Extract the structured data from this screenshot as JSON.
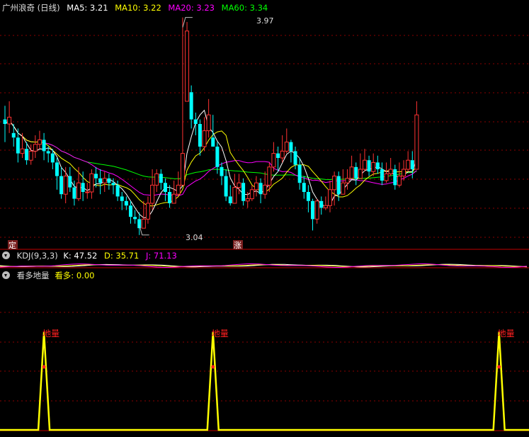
{
  "main_panel": {
    "title": "广州浪奇 (日线)",
    "ma_labels": [
      {
        "label": "MA5: 3.21",
        "color": "#ffffff"
      },
      {
        "label": "MA10: 3.22",
        "color": "#ffff00"
      },
      {
        "label": "MA20: 3.23",
        "color": "#ff00ff"
      },
      {
        "label": "MA60: 3.34",
        "color": "#00ff00"
      }
    ],
    "high_label": "3.97",
    "low_label": "3.04",
    "marker_ding": "定",
    "marker_zhang": "涨"
  },
  "kdj_panel": {
    "title": "KDJ(9,3,3)",
    "k_label": "K: 47.52",
    "d_label": "D: 35.71",
    "j_label": "J: 71.13"
  },
  "indicator_panel": {
    "title": "看多地量",
    "value_label": "看多: 0.00",
    "peak_label": "地量"
  },
  "colors": {
    "up": "#ff3232",
    "down": "#00ffff",
    "ma5": "#ffffff",
    "ma10": "#ffff00",
    "ma20": "#ff00ff",
    "ma60": "#00ff00",
    "signal": "#ffff00",
    "grid": "#8b0000"
  },
  "chart_data": [
    {
      "type": "candlestick",
      "title": "广州浪奇 (日线)",
      "series_names": [
        "MA5",
        "MA10",
        "MA20",
        "MA60"
      ],
      "yrange": [
        3.0,
        4.0
      ],
      "candles": [
        [
          3.52,
          3.5,
          3.58,
          3.42
        ],
        [
          3.5,
          3.53,
          3.6,
          3.46
        ],
        [
          3.46,
          3.44,
          3.5,
          3.4
        ],
        [
          3.44,
          3.37,
          3.48,
          3.33
        ],
        [
          3.37,
          3.39,
          3.46,
          3.35
        ],
        [
          3.39,
          3.34,
          3.42,
          3.32
        ],
        [
          3.34,
          3.38,
          3.41,
          3.32
        ],
        [
          3.38,
          3.41,
          3.45,
          3.35
        ],
        [
          3.41,
          3.43,
          3.47,
          3.39
        ],
        [
          3.43,
          3.38,
          3.46,
          3.34
        ],
        [
          3.38,
          3.37,
          3.4,
          3.33
        ],
        [
          3.37,
          3.33,
          3.39,
          3.3
        ],
        [
          3.33,
          3.27,
          3.35,
          3.21
        ],
        [
          3.27,
          3.19,
          3.31,
          3.17
        ],
        [
          3.19,
          3.27,
          3.31,
          3.15
        ],
        [
          3.27,
          3.22,
          3.31,
          3.2
        ],
        [
          3.22,
          3.17,
          3.25,
          3.14
        ],
        [
          3.17,
          3.24,
          3.31,
          3.16
        ],
        [
          3.24,
          3.2,
          3.29,
          3.16
        ],
        [
          3.2,
          3.2,
          3.24,
          3.17
        ],
        [
          3.2,
          3.28,
          3.3,
          3.17
        ],
        [
          3.28,
          3.26,
          3.31,
          3.22
        ],
        [
          3.26,
          3.24,
          3.3,
          3.19
        ],
        [
          3.24,
          3.26,
          3.29,
          3.2
        ],
        [
          3.26,
          3.24,
          3.28,
          3.21
        ],
        [
          3.24,
          3.23,
          3.26,
          3.19
        ],
        [
          3.23,
          3.18,
          3.25,
          3.16
        ],
        [
          3.18,
          3.16,
          3.2,
          3.12
        ],
        [
          3.16,
          3.14,
          3.18,
          3.12
        ],
        [
          3.14,
          3.09,
          3.16,
          3.06
        ],
        [
          3.09,
          3.08,
          3.12,
          3.06
        ],
        [
          3.08,
          3.04,
          3.11,
          3.01
        ],
        [
          3.04,
          3.08,
          3.16,
          3.04
        ],
        [
          3.08,
          3.15,
          3.18,
          3.06
        ],
        [
          3.15,
          3.23,
          3.3,
          3.12
        ],
        [
          3.23,
          3.28,
          3.3,
          3.2
        ],
        [
          3.28,
          3.24,
          3.3,
          3.21
        ],
        [
          3.24,
          3.2,
          3.26,
          3.16
        ],
        [
          3.2,
          3.15,
          3.23,
          3.13
        ],
        [
          3.15,
          3.19,
          3.25,
          3.15
        ],
        [
          3.19,
          3.23,
          3.29,
          3.18
        ],
        [
          3.23,
          3.37,
          3.97,
          3.34
        ],
        [
          3.6,
          3.91,
          3.95,
          3.65
        ],
        [
          3.64,
          3.52,
          3.67,
          3.48
        ],
        [
          3.52,
          3.5,
          3.55,
          3.45
        ],
        [
          3.5,
          3.4,
          3.52,
          3.36
        ],
        [
          3.4,
          3.47,
          3.53,
          3.38
        ],
        [
          3.47,
          3.54,
          3.61,
          3.44
        ],
        [
          3.44,
          3.4,
          3.54,
          3.4
        ],
        [
          3.4,
          3.31,
          3.42,
          3.28
        ],
        [
          3.31,
          3.27,
          3.33,
          3.23
        ],
        [
          3.27,
          3.18,
          3.3,
          3.16
        ],
        [
          3.18,
          3.15,
          3.23,
          3.14
        ],
        [
          3.15,
          3.22,
          3.28,
          3.15
        ],
        [
          3.22,
          3.24,
          3.28,
          3.19
        ],
        [
          3.24,
          3.16,
          3.26,
          3.14
        ],
        [
          3.16,
          3.17,
          3.2,
          3.13
        ],
        [
          3.17,
          3.21,
          3.23,
          3.16
        ],
        [
          3.21,
          3.24,
          3.27,
          3.18
        ],
        [
          3.24,
          3.19,
          3.26,
          3.15
        ],
        [
          3.19,
          3.23,
          3.29,
          3.17
        ],
        [
          3.23,
          3.31,
          3.33,
          3.2
        ],
        [
          3.31,
          3.37,
          3.42,
          3.29
        ],
        [
          3.37,
          3.35,
          3.4,
          3.29
        ],
        [
          3.35,
          3.38,
          3.45,
          3.33
        ],
        [
          3.38,
          3.42,
          3.48,
          3.37
        ],
        [
          3.42,
          3.38,
          3.43,
          3.33
        ],
        [
          3.38,
          3.32,
          3.4,
          3.3
        ],
        [
          3.32,
          3.24,
          3.35,
          3.21
        ],
        [
          3.24,
          3.2,
          3.27,
          3.17
        ],
        [
          3.2,
          3.16,
          3.23,
          3.11
        ],
        [
          3.16,
          3.08,
          3.17,
          3.03
        ],
        [
          3.08,
          3.16,
          3.17,
          3.06
        ],
        [
          3.16,
          3.13,
          3.18,
          3.1
        ],
        [
          3.13,
          3.14,
          3.18,
          3.12
        ],
        [
          3.14,
          3.21,
          3.25,
          3.11
        ],
        [
          3.21,
          3.27,
          3.29,
          3.14
        ],
        [
          3.27,
          3.19,
          3.29,
          3.16
        ],
        [
          3.19,
          3.24,
          3.3,
          3.19
        ],
        [
          3.24,
          3.26,
          3.3,
          3.21
        ],
        [
          3.26,
          3.31,
          3.36,
          3.26
        ],
        [
          3.31,
          3.26,
          3.33,
          3.23
        ],
        [
          3.26,
          3.3,
          3.37,
          3.26
        ],
        [
          3.3,
          3.34,
          3.39,
          3.29
        ],
        [
          3.34,
          3.29,
          3.36,
          3.27
        ],
        [
          3.29,
          3.33,
          3.37,
          3.27
        ],
        [
          3.33,
          3.3,
          3.36,
          3.28
        ],
        [
          3.3,
          3.25,
          3.33,
          3.23
        ],
        [
          3.25,
          3.28,
          3.33,
          3.24
        ],
        [
          3.28,
          3.3,
          3.35,
          3.27
        ],
        [
          3.3,
          3.23,
          3.32,
          3.21
        ],
        [
          3.23,
          3.27,
          3.33,
          3.22
        ],
        [
          3.27,
          3.3,
          3.34,
          3.25
        ],
        [
          3.3,
          3.34,
          3.38,
          3.29
        ],
        [
          3.34,
          3.3,
          3.38,
          3.26
        ],
        [
          3.3,
          3.54,
          3.6,
          3.3
        ]
      ]
    },
    {
      "type": "line",
      "title": "KDJ(9,3,3)",
      "series": [
        {
          "name": "K",
          "last": 47.52
        },
        {
          "name": "D",
          "last": 35.71
        },
        {
          "name": "J",
          "last": 71.13
        }
      ]
    },
    {
      "type": "line",
      "title": "看多地量",
      "series": [
        {
          "name": "看多",
          "last": 0.0
        }
      ],
      "pulses_at_bar": [
        9,
        48,
        114
      ],
      "peak_value": 1.0
    }
  ]
}
